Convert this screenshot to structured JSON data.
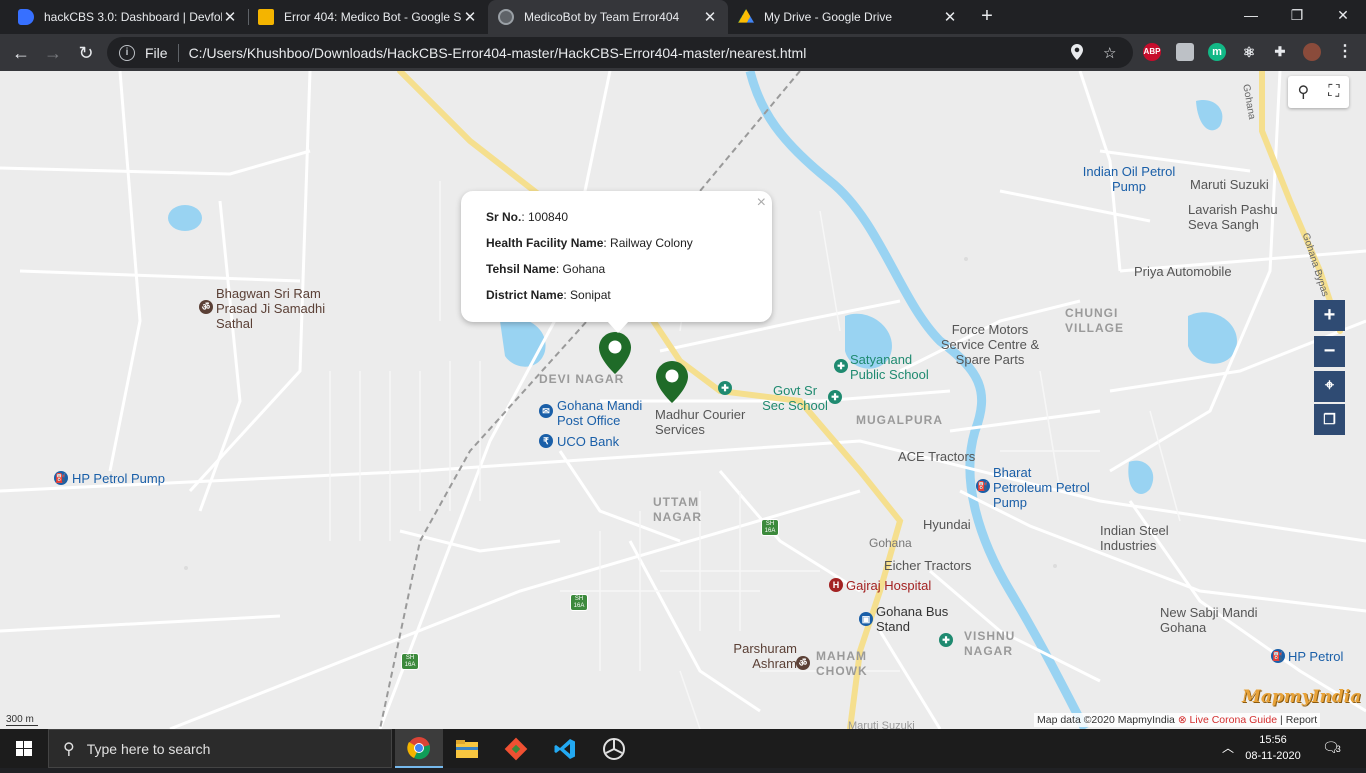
{
  "browser": {
    "tabs": [
      {
        "title": "hackCBS 3.0: Dashboard | Devfoli",
        "icon": "devfolio-icon",
        "color": "#3770ff"
      },
      {
        "title": "Error 404: Medico Bot - Google S",
        "icon": "google-slides-icon",
        "color": "#f4b400"
      },
      {
        "title": "MedicoBot by Team Error404",
        "icon": "globe-icon",
        "color": "#9aa0a6"
      },
      {
        "title": "My Drive - Google Drive",
        "icon": "google-drive-icon",
        "color": "#34a853"
      }
    ],
    "address": {
      "scheme_label": "File",
      "url": "C:/Users/Khushboo/Downloads/HackCBS-Error404-master/HackCBS-Error404-master/nearest.html"
    },
    "extensions": [
      {
        "name": "adblock-icon",
        "label": "ABP",
        "color": "#c70d2c"
      },
      {
        "name": "extension-square-icon",
        "label": "",
        "color": "#9aa0a6"
      },
      {
        "name": "m-extension-icon",
        "label": "m",
        "color": "#12b886"
      },
      {
        "name": "react-devtools-icon",
        "label": "",
        "color": "#61dafb"
      },
      {
        "name": "puzzle-icon",
        "label": "",
        "color": "#e8eaed"
      }
    ]
  },
  "map": {
    "popup": {
      "rows": [
        {
          "key": "Sr No.",
          "value": ": 100840"
        },
        {
          "key": "Health Facility Name",
          "value": ": Railway Colony"
        },
        {
          "key": "Tehsil Name",
          "value": ": Gohana"
        },
        {
          "key": "District Name",
          "value": ": Sonipat"
        }
      ],
      "close": "×"
    },
    "areas": [
      {
        "text": "DEVI NAGAR"
      },
      {
        "text": "MUGALPURA"
      },
      {
        "text": "UTTAM NAGAR"
      },
      {
        "text": "CHUNGI VILLAGE"
      },
      {
        "text": "VISHNU NAGAR"
      },
      {
        "text": "MAHAM CHOWK"
      }
    ],
    "pois": [
      {
        "text": "Bhagwan Sri Ram Prasad Ji Samadhi Sathal",
        "kind": "temple"
      },
      {
        "text": "Gohana Mandi Post Office",
        "kind": "post-office"
      },
      {
        "text": "UCO Bank",
        "kind": "bank"
      },
      {
        "text": "HP Petrol Pump",
        "kind": "fuel"
      },
      {
        "text": "Madhur Courier Services",
        "kind": "courier"
      },
      {
        "text": "Satyanand Public School",
        "kind": "school"
      },
      {
        "text": "Govt Sr Sec School",
        "kind": "school"
      },
      {
        "text": "Force Motors Service Centre & Spare Parts",
        "kind": "shop"
      },
      {
        "text": "Indian Oil Petrol Pump",
        "kind": "fuel"
      },
      {
        "text": "Maruti Suzuki",
        "kind": "shop"
      },
      {
        "text": "Lavarish Pashu Seva Sangh",
        "kind": "ngo"
      },
      {
        "text": "Priya Automobile",
        "kind": "shop"
      },
      {
        "text": "ACE Tractors",
        "kind": "shop"
      },
      {
        "text": "Bharat Petroleum Petrol Pump",
        "kind": "fuel"
      },
      {
        "text": "Hyundai",
        "kind": "shop"
      },
      {
        "text": "Gohana",
        "kind": "city"
      },
      {
        "text": "Eicher Tractors",
        "kind": "shop"
      },
      {
        "text": "Gajraj Hospital",
        "kind": "hospital"
      },
      {
        "text": "Gohana Bus Stand",
        "kind": "bus"
      },
      {
        "text": "Parshuram Ashram",
        "kind": "temple"
      },
      {
        "text": "Indian Steel Industries",
        "kind": "shop"
      },
      {
        "text": "New Sabji Mandi Gohana",
        "kind": "market"
      },
      {
        "text": "HP Petrol",
        "kind": "fuel"
      },
      {
        "text": "Maruti Suzuki",
        "kind": "shop"
      }
    ],
    "roads": [
      {
        "text": "Gohana"
      },
      {
        "text": "Gohana Bypas"
      }
    ],
    "shields": [
      "SH 16A",
      "SH 16A",
      "SH 16A"
    ],
    "controls": {
      "zoom_in": "+",
      "zoom_out": "−"
    },
    "scale": "300 m",
    "attribution": {
      "data": "Map data ©2020 MapmyIndia",
      "corona": "Live Corona Guide",
      "sep": "|",
      "report": "Report"
    },
    "logo": "MapmyIndia"
  },
  "taskbar": {
    "search_placeholder": "Type here to search",
    "time": "15:56",
    "date": "08-11-2020",
    "notifications": "3"
  }
}
